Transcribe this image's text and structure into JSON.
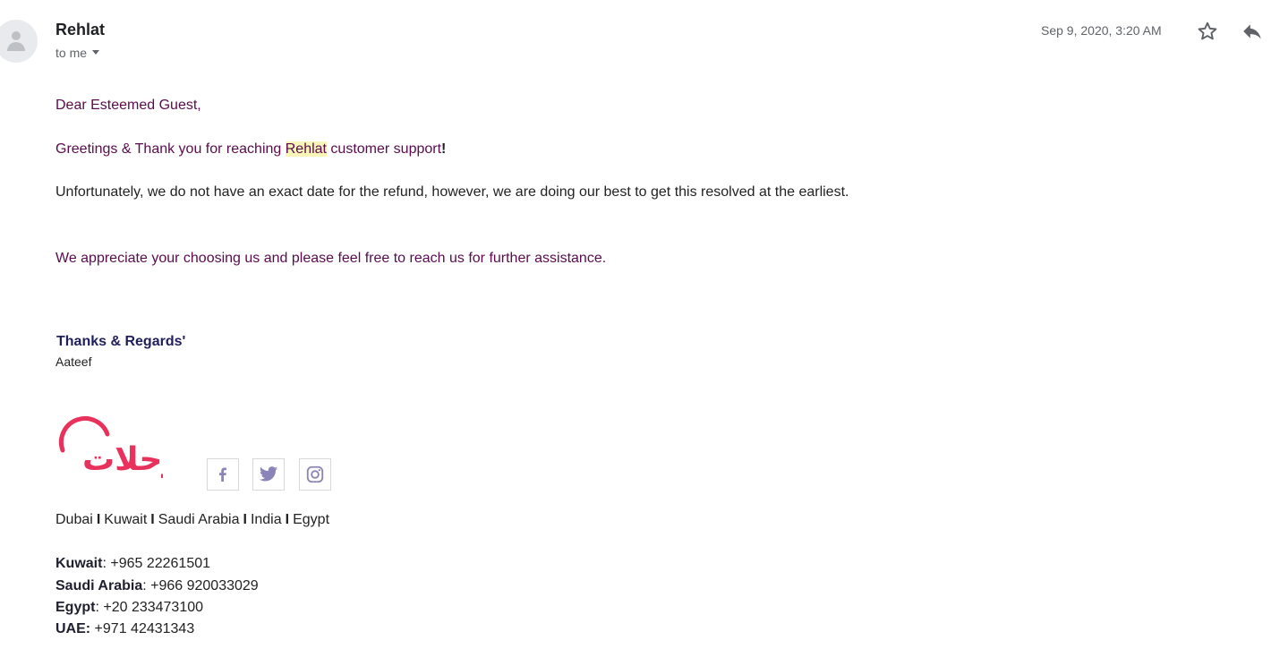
{
  "email": {
    "sender": "Rehlat",
    "recipient": "to me",
    "date": "Sep 9, 2020, 3:20 AM"
  },
  "message": {
    "greeting": "Dear Esteemed Guest,",
    "line1_before": "Greetings & Thank you for reaching ",
    "line1_highlight": "Rehlat",
    "line1_after": " customer support",
    "line1_end": "!",
    "line2": "Unfortunately, we do not have an exact date for the refund, however, we are doing our best to get this resolved at the earliest.",
    "line3": "We appreciate your choosing us and please feel free to reach us for further assistance."
  },
  "signature": {
    "closing": "Thanks & Regards'",
    "agent": "Aateef",
    "logo_text": "رحلات",
    "countries": [
      "Dubai",
      "Kuwait",
      "Saudi Arabia",
      "India",
      "Egypt"
    ],
    "country_separator": "I",
    "phones": [
      {
        "label": "Kuwait",
        "sep": ":",
        "number": " +965 22261501"
      },
      {
        "label": "Saudi Arabia",
        "sep": ":",
        "number": " +966 920033029"
      },
      {
        "label": "Egypt",
        "sep": ":",
        "number": " +20 233473100"
      },
      {
        "label": "UAE:",
        "sep": "",
        "number": " +971 42431343"
      }
    ]
  },
  "icons": {
    "star": "star-icon",
    "reply": "reply-icon",
    "facebook": "facebook-icon",
    "twitter": "twitter-icon",
    "instagram": "instagram-icon"
  },
  "colors": {
    "brand": "#e8315b",
    "social_icon": "#8b84b8",
    "highlight": "#f8f5b8"
  }
}
